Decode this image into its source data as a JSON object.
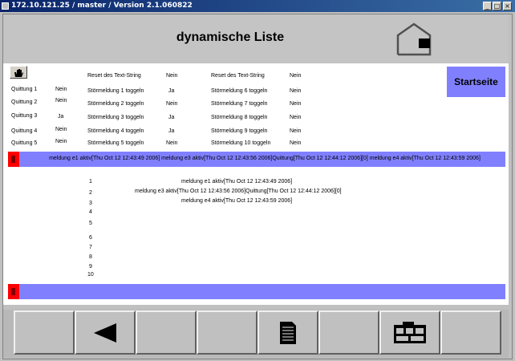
{
  "window": {
    "title": "172.10.121.25  / master / Version 2.1.060822"
  },
  "header": {
    "title": "dynamische Liste"
  },
  "nav": {
    "startseite_label": "Startseite"
  },
  "grid": {
    "header_row": [
      "Reset des Text-String",
      "Nein",
      "Reset des Text-String",
      "Nein"
    ],
    "rows": [
      {
        "quittung": "Quittung 1",
        "q_value": "Nein",
        "left_label": "Störmeldung 1 toggeln",
        "left_value": "Ja",
        "right_label": "Störmeldung 6 toggeln",
        "right_value": "Nein"
      },
      {
        "quittung": "Quittung 2",
        "q_value": "Nein",
        "left_label": "Störmeldung 2 toggeln",
        "left_value": "Nein",
        "right_label": "Störmeldung 7 toggeln",
        "right_value": "Nein"
      },
      {
        "quittung": "Quittung 3",
        "q_value": "Ja",
        "left_label": "Störmeldung 3 toggeln",
        "left_value": "Ja",
        "right_label": "Störmeldung 8 toggeln",
        "right_value": "Nein"
      },
      {
        "quittung": "Quittung 4",
        "q_value": "Nein",
        "left_label": "Störmeldung 4 toggeln",
        "left_value": "Ja",
        "right_label": "Störmeldung 9 toggeln",
        "right_value": "Nein"
      },
      {
        "quittung": "Quittung 5",
        "q_value": "Nein",
        "left_label": "Störmeldung 5 toggeln",
        "left_value": "Nein",
        "right_label": "Störmeldung 10 toggeln",
        "right_value": "Nein"
      }
    ]
  },
  "message_bar_top": {
    "text": "meldung e1 aktiv[Thu Oct 12 12:43:49 2006] meldung e3 aktiv[Thu Oct 12 12:43:56 2006]Quittung[Thu Oct 12 12:44:12 2006][0] meldung e4 aktiv[Thu Oct 12 12:43:59 2006]"
  },
  "message_bar_bottom": {
    "text": ""
  },
  "list": {
    "items": [
      {
        "num": "1",
        "text": "meldung e1 aktiv[Thu Oct 12 12:43:49 2006]"
      },
      {
        "num": "2",
        "text": "meldung e3 aktiv[Thu Oct 12 12:43:56 2006]Quittung[Thu Oct 12 12:44:12 2006][0]"
      },
      {
        "num": "3",
        "text": "meldung e4 aktiv[Thu Oct 12 12:43:59 2006]"
      },
      {
        "num": "4",
        "text": ""
      },
      {
        "num": "5",
        "text": ""
      },
      {
        "num": "6",
        "text": ""
      },
      {
        "num": "7",
        "text": ""
      },
      {
        "num": "8",
        "text": ""
      },
      {
        "num": "9",
        "text": ""
      },
      {
        "num": "10",
        "text": ""
      }
    ]
  },
  "toolbar": {
    "buttons": [
      {
        "icon": "back-arrow-icon"
      },
      {
        "icon": ""
      },
      {
        "icon": ""
      },
      {
        "icon": "document-icon"
      },
      {
        "icon": ""
      },
      {
        "icon": "floorplan-icon"
      },
      {
        "icon": ""
      }
    ]
  },
  "colors": {
    "accent": "#8080ff",
    "alarm": "#ff0000",
    "titlebar": "#0a246a"
  }
}
